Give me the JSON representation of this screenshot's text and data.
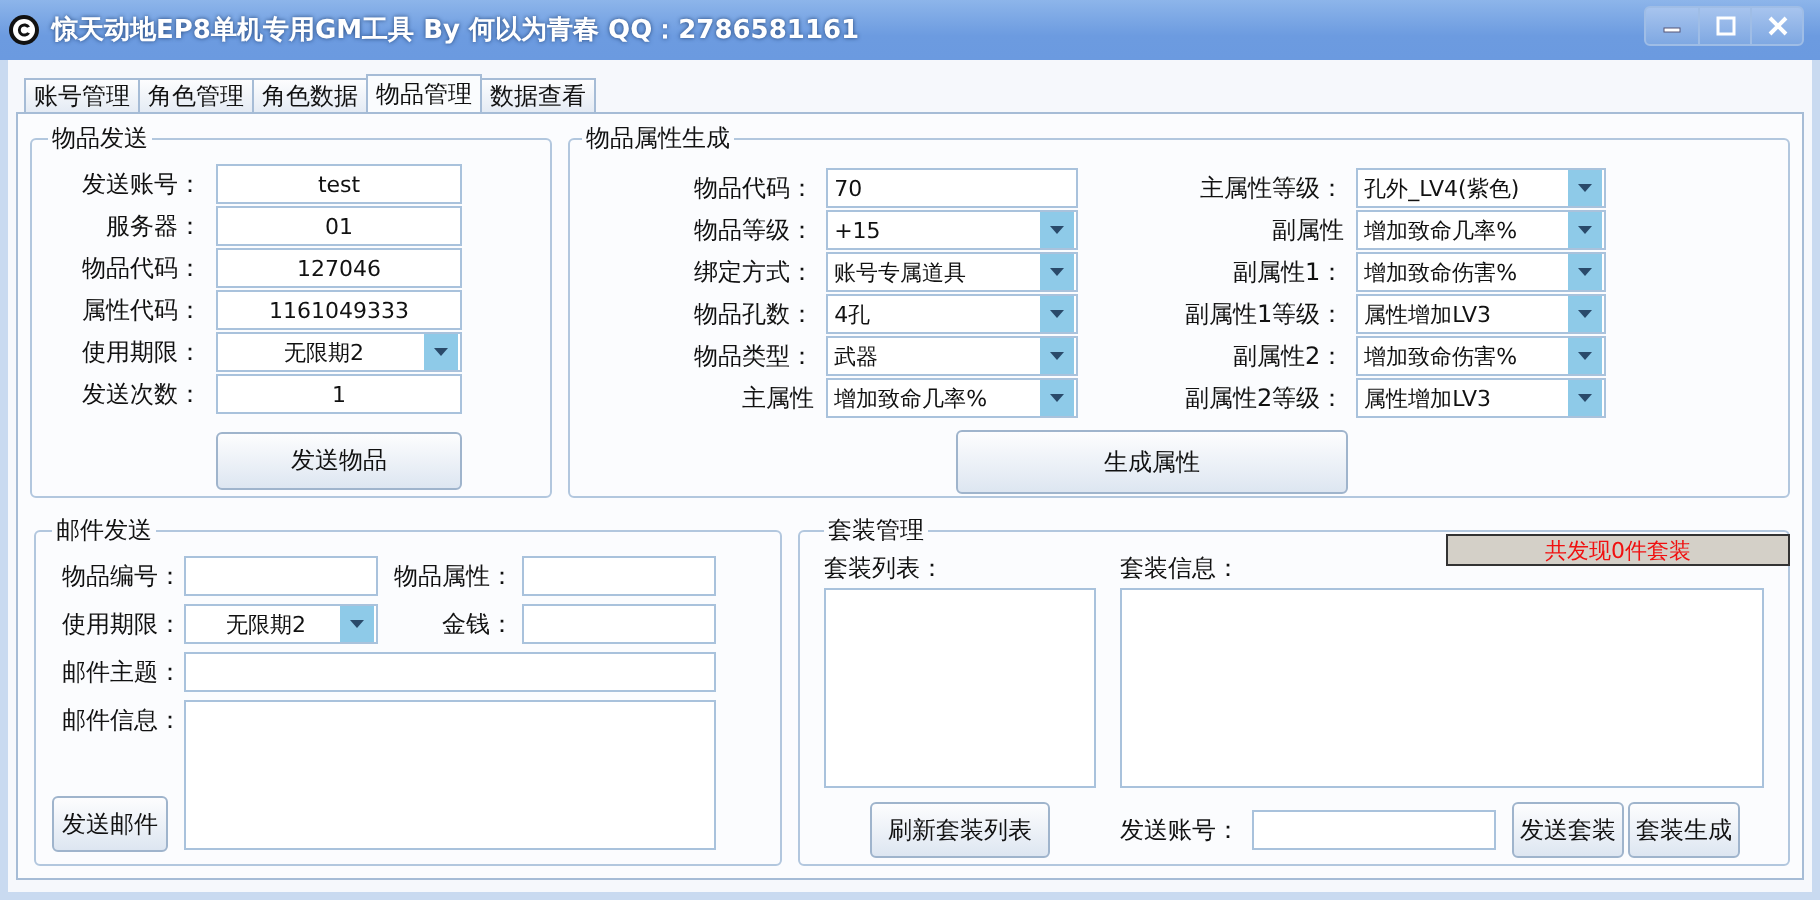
{
  "window": {
    "title": "惊天动地EP8单机专用GM工具 By 何以为青春 QQ：2786581161"
  },
  "tabs": [
    {
      "label": "账号管理",
      "selected": false
    },
    {
      "label": "角色管理",
      "selected": false
    },
    {
      "label": "角色数据",
      "selected": false
    },
    {
      "label": "物品管理",
      "selected": true
    },
    {
      "label": "数据查看",
      "selected": false
    }
  ],
  "item_send": {
    "title": "物品发送",
    "fields": [
      {
        "label": "发送账号：",
        "value": "test",
        "kind": "text"
      },
      {
        "label": "服务器：",
        "value": "01",
        "kind": "text"
      },
      {
        "label": "物品代码：",
        "value": "127046",
        "kind": "text"
      },
      {
        "label": "属性代码：",
        "value": "1161049333",
        "kind": "text"
      },
      {
        "label": "使用期限：",
        "value": "无限期2",
        "kind": "dropdown"
      },
      {
        "label": "发送次数：",
        "value": "1",
        "kind": "text"
      }
    ],
    "button": "发送物品"
  },
  "item_attr": {
    "title": "物品属性生成",
    "rows": [
      {
        "left": {
          "label": "物品代码：",
          "value": "70",
          "kind": "text"
        },
        "right": {
          "label": "主属性等级：",
          "value": "孔外_LV4(紫色)",
          "kind": "dropdown"
        }
      },
      {
        "left": {
          "label": "物品等级：",
          "value": "+15",
          "kind": "dropdown"
        },
        "right": {
          "label": "副属性",
          "value": "增加致命几率%",
          "kind": "dropdown"
        }
      },
      {
        "left": {
          "label": "绑定方式：",
          "value": "账号专属道具",
          "kind": "dropdown"
        },
        "right": {
          "label": "副属性1：",
          "value": "增加致命伤害%",
          "kind": "dropdown"
        }
      },
      {
        "left": {
          "label": "物品孔数：",
          "value": "4孔",
          "kind": "dropdown"
        },
        "right": {
          "label": "副属性1等级：",
          "value": "属性增加LV3",
          "kind": "dropdown"
        }
      },
      {
        "left": {
          "label": "物品类型：",
          "value": "武器",
          "kind": "dropdown"
        },
        "right": {
          "label": "副属性2：",
          "value": "增加致命伤害%",
          "kind": "dropdown"
        }
      },
      {
        "left": {
          "label": "主属性",
          "value": "增加致命几率%",
          "kind": "dropdown"
        },
        "right": {
          "label": "副属性2等级：",
          "value": "属性增加LV3",
          "kind": "dropdown"
        }
      }
    ],
    "button": "生成属性"
  },
  "mail": {
    "title": "邮件发送",
    "item_no_label": "物品编号：",
    "item_attr_label": "物品属性：",
    "period_label": "使用期限：",
    "period_value": "无限期2",
    "money_label": "金钱：",
    "subject_label": "邮件主题：",
    "message_label": "邮件信息：",
    "button": "发送邮件"
  },
  "suit": {
    "title": "套装管理",
    "status": "共发现0件套装",
    "list_label": "套装列表：",
    "info_label": "套装信息：",
    "refresh_button": "刷新套装列表",
    "account_label": "发送账号：",
    "send_button": "发送套装",
    "generate_button": "套装生成"
  }
}
